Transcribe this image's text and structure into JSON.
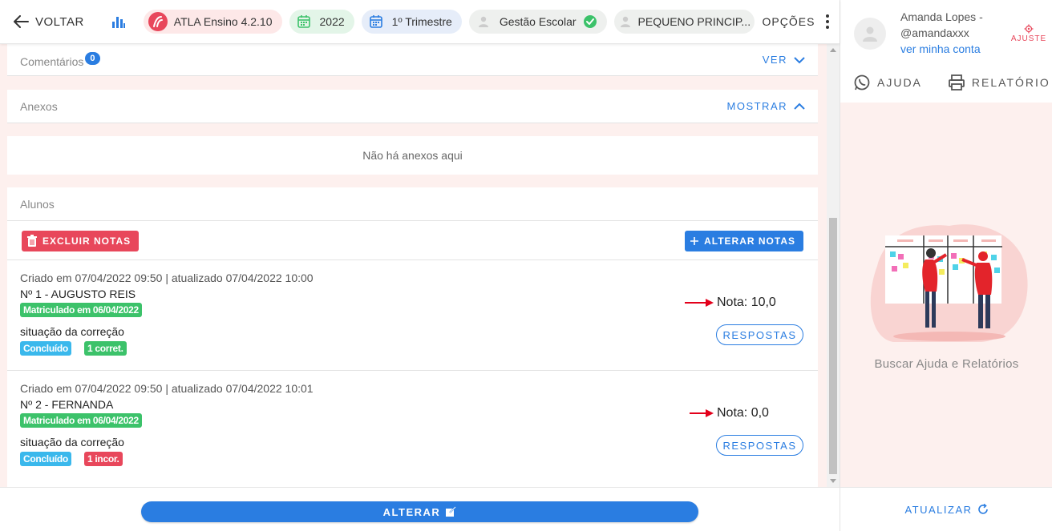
{
  "topbar": {
    "back_label": "VOLTAR",
    "chips": {
      "atla": "ATLA Ensino 4.2.10",
      "year": "2022",
      "trimester": "1º Trimestre",
      "gestao": "Gestão Escolar",
      "pequeno": "PEQUENO PRINCIP..."
    },
    "opcoes": "OPÇÕES"
  },
  "sections": {
    "comentarios": {
      "title": "Comentários",
      "count": "0",
      "action": "VER"
    },
    "anexos": {
      "title": "Anexos",
      "action": "MOSTRAR",
      "empty": "Não há anexos aqui"
    },
    "alunos": {
      "title": "Alunos",
      "delete_label": "EXCLUIR NOTAS",
      "edit_label": "ALTERAR NOTAS"
    }
  },
  "students": [
    {
      "meta": "Criado em 07/04/2022 09:50 | atualizado 07/04/2022 10:00",
      "name": "Nº 1 - AUGUSTO REIS",
      "enrolled": "Matriculado em 06/04/2022",
      "situation_label": "situação da correção",
      "status": "Concluído",
      "correction": "1 corret.",
      "grade": "Nota: 10,0",
      "answers_label": "RESPOSTAS"
    },
    {
      "meta": "Criado em 07/04/2022 09:50 | atualizado 07/04/2022 10:01",
      "name": "Nº 2 - FERNANDA",
      "enrolled": "Matriculado em 06/04/2022",
      "situation_label": "situação da correção",
      "status": "Concluído",
      "correction": "1 incor.",
      "grade": "Nota: 0,0",
      "answers_label": "RESPOSTAS"
    }
  ],
  "bottom": {
    "alterar_label": "ALTERAR"
  },
  "right_panel": {
    "user_name": "Amanda Lopes - @amandaxxx",
    "account_link": "ver minha conta",
    "settings_label": "AJUSTE",
    "help_label": "AJUDA",
    "report_label": "RELATÓRIO",
    "illustration_caption": "Buscar Ajuda e Relatórios",
    "refresh_label": "ATUALIZAR"
  },
  "colors": {
    "accent": "#2a7de1",
    "danger": "#e8475b",
    "success": "#3cc26a",
    "info": "#3ab8ec",
    "background": "#fdf0ee"
  }
}
